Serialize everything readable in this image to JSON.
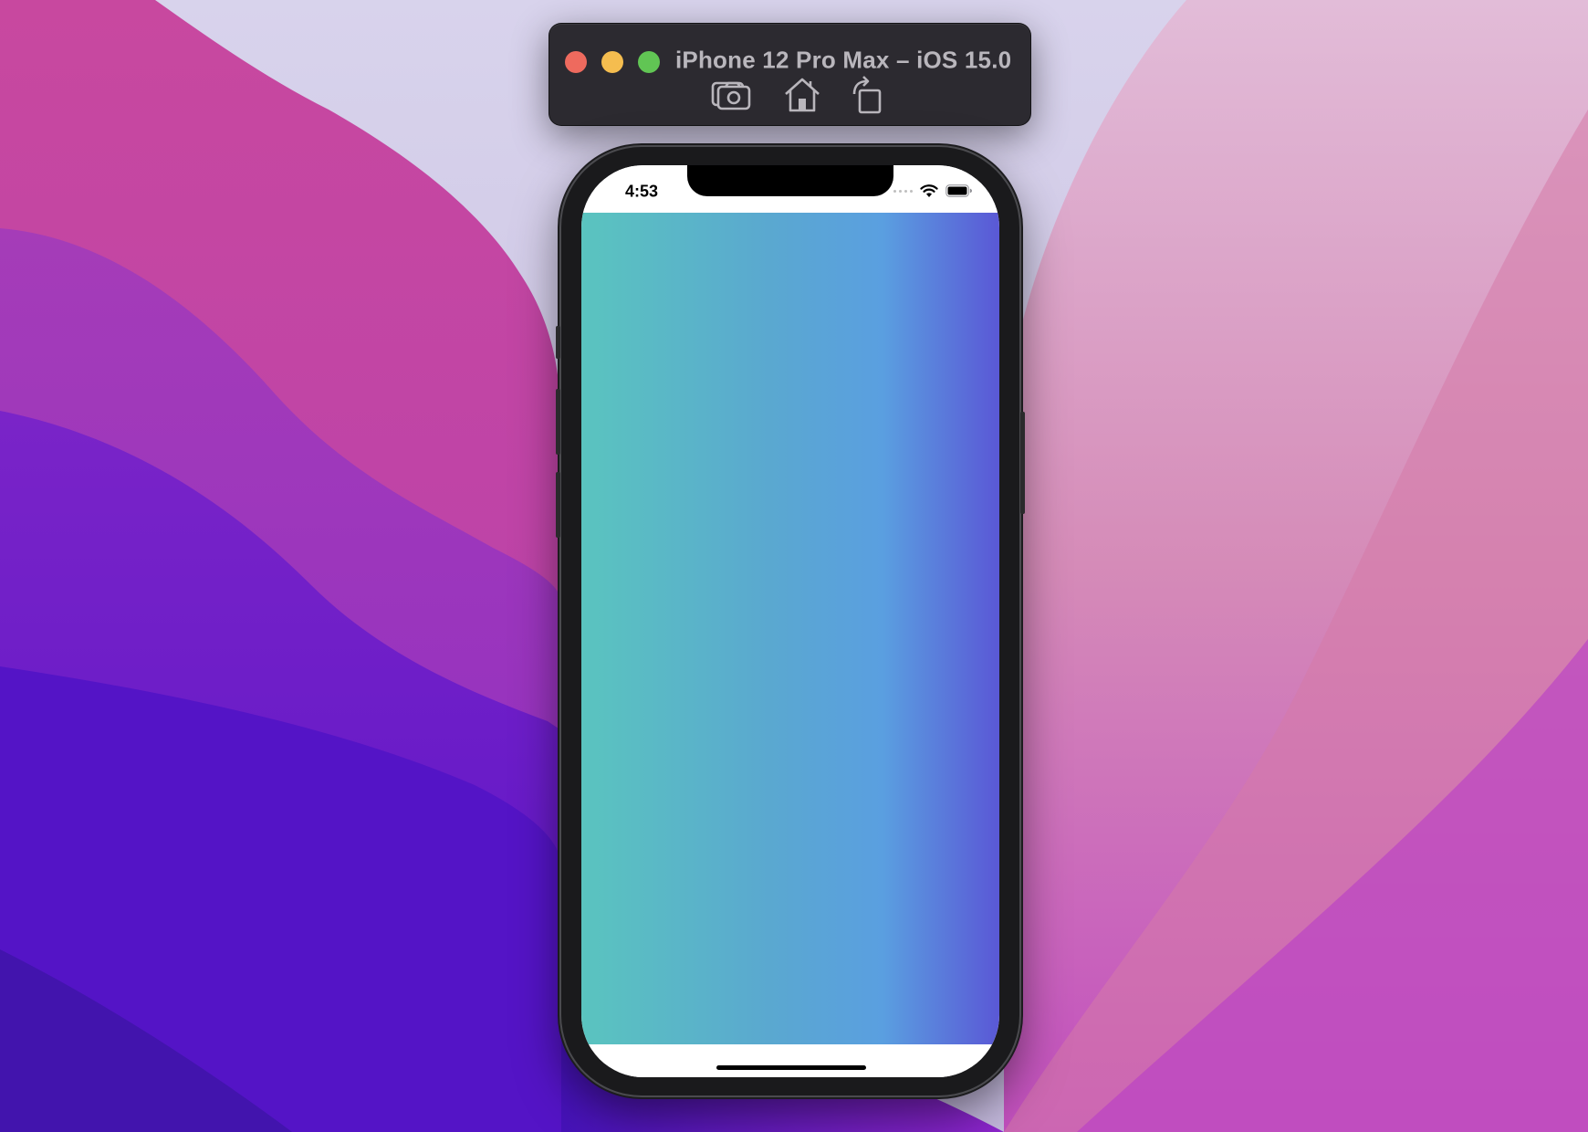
{
  "window": {
    "title": "iPhone 12 Pro Max – iOS 15.0",
    "traffic_lights": {
      "close": "#ee6a5e",
      "minimize": "#f5bd4f",
      "zoom": "#61c554"
    },
    "toolbar": [
      {
        "name": "screenshot",
        "icon": "camera-icon"
      },
      {
        "name": "home",
        "icon": "home-icon"
      },
      {
        "name": "rotate",
        "icon": "rotate-icon"
      }
    ]
  },
  "device": {
    "model": "iPhone 12 Pro Max",
    "status_bar": {
      "time": "4:53",
      "icons": [
        "signal-icon",
        "wifi-icon",
        "battery-icon"
      ]
    },
    "content": {
      "gradient_colors": [
        "#5ac4bf",
        "#5aa8d0",
        "#5a9fe0",
        "#5a58d6"
      ]
    }
  },
  "desktop": {
    "wallpaper": "macOS Monterey",
    "colors": [
      "#c9c4e2",
      "#c84ba6",
      "#8a2bcf",
      "#4f10c8",
      "#d9a8c9",
      "#d070a4"
    ]
  }
}
